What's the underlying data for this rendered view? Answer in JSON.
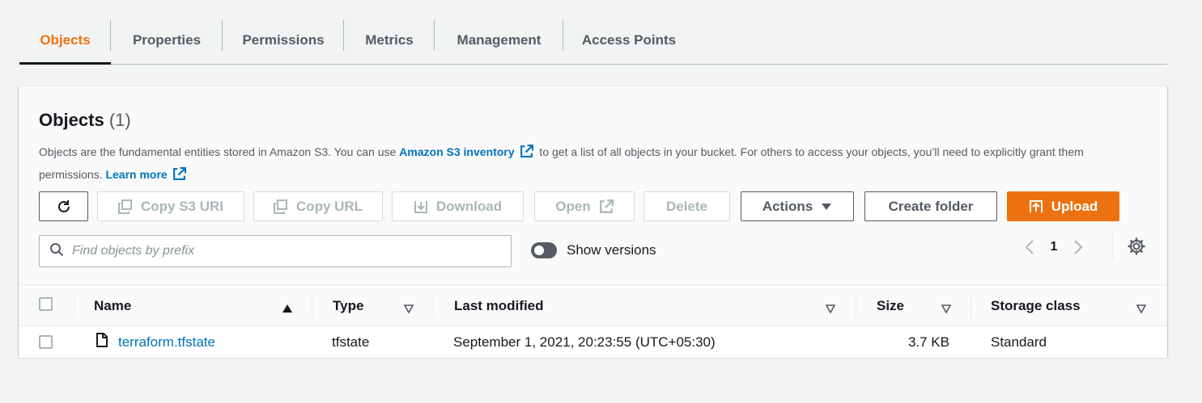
{
  "tabs": [
    {
      "label": "Objects",
      "active": true
    },
    {
      "label": "Properties"
    },
    {
      "label": "Permissions"
    },
    {
      "label": "Metrics"
    },
    {
      "label": "Management"
    },
    {
      "label": "Access Points"
    }
  ],
  "panel": {
    "title": "Objects",
    "count": "(1)",
    "desc_part1": "Objects are the fundamental entities stored in Amazon S3. You can use ",
    "desc_link1": "Amazon S3 inventory",
    "desc_part2": " to get a list of all objects in your bucket. For others to access your objects, you’ll need to explicitly grant them permissions. ",
    "desc_link2": "Learn more"
  },
  "toolbar": {
    "refresh_icon": "refresh-icon",
    "copy_s3_uri": "Copy S3 URI",
    "copy_url": "Copy URL",
    "download": "Download",
    "open": "Open",
    "delete": "Delete",
    "actions": "Actions",
    "create_folder": "Create folder",
    "upload": "Upload"
  },
  "search": {
    "placeholder": "Find objects by prefix",
    "value": ""
  },
  "versions": {
    "label": "Show versions",
    "enabled": false
  },
  "pagination": {
    "current_page": "1"
  },
  "table": {
    "columns": {
      "name": "Name",
      "type": "Type",
      "last_modified": "Last modified",
      "size": "Size",
      "storage_class": "Storage class"
    },
    "rows": [
      {
        "name": "terraform.tfstate",
        "type": "tfstate",
        "last_modified": "September 1, 2021, 20:23:55 (UTC+05:30)",
        "size": "3.7 KB",
        "storage_class": "Standard"
      }
    ]
  },
  "colors": {
    "accent": "#ec7211",
    "link": "#0073bb",
    "text": "#16191f",
    "muted": "#545b64",
    "disabled": "#aab7b8"
  }
}
